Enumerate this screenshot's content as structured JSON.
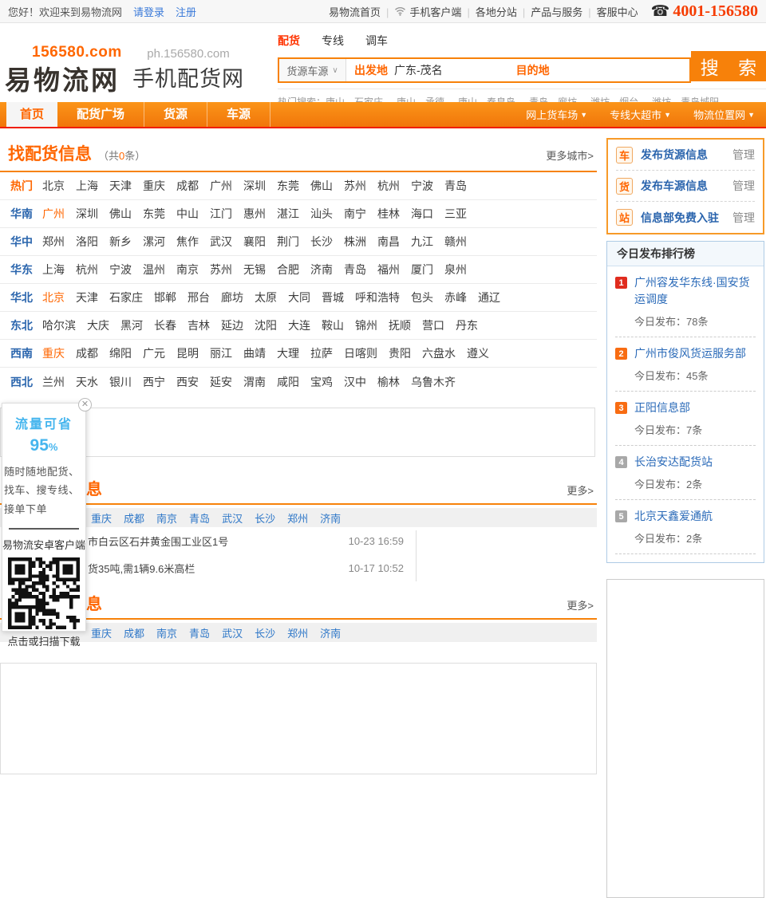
{
  "topbar": {
    "welcome": "您好！欢迎来到易物流网",
    "login": "请登录",
    "register": "注册",
    "home_link": "易物流首页",
    "links": [
      "手机客户端",
      "各地分站",
      "产品与服务",
      "客服中心"
    ],
    "phone": "4001-156580"
  },
  "header": {
    "logo_domain": "156580.com",
    "logo_name": "易物流网",
    "sub_domain": "ph.156580.com",
    "sub_name": "手机配货网",
    "search": {
      "tabs": [
        "配货",
        "专线",
        "调车"
      ],
      "active_tab": 0,
      "category": "货源车源",
      "from_label": "出发地",
      "from_value": "广东-茂名",
      "to_label": "目的地",
      "button": "搜 索",
      "hot_label": "热门搜索：",
      "hot": [
        "唐山→石家庄",
        "唐山→承德",
        "唐山→秦皇岛",
        "青岛→廊坊",
        "潍坊→烟台",
        "潍坊→青岛城阳"
      ]
    }
  },
  "nav": {
    "items": [
      "首页",
      "配货广场",
      "货源",
      "车源"
    ],
    "active_index": 0,
    "right": [
      "网上货车场",
      "专线大超市",
      "物流位置网"
    ]
  },
  "find": {
    "title": "找配货信息",
    "count_prefix": "（共",
    "count": "0",
    "count_suffix": "条）",
    "more": "更多城市>",
    "rows": [
      {
        "label": "热门",
        "label_style": "hot",
        "highlight": [],
        "cities": [
          "北京",
          "上海",
          "天津",
          "重庆",
          "成都",
          "广州",
          "深圳",
          "东莞",
          "佛山",
          "苏州",
          "杭州",
          "宁波",
          "青岛"
        ]
      },
      {
        "label": "华南",
        "label_style": "region",
        "highlight": [
          0
        ],
        "cities": [
          "广州",
          "深圳",
          "佛山",
          "东莞",
          "中山",
          "江门",
          "惠州",
          "湛江",
          "汕头",
          "南宁",
          "桂林",
          "海口",
          "三亚"
        ]
      },
      {
        "label": "华中",
        "label_style": "region",
        "highlight": [],
        "cities": [
          "郑州",
          "洛阳",
          "新乡",
          "漯河",
          "焦作",
          "武汉",
          "襄阳",
          "荆门",
          "长沙",
          "株洲",
          "南昌",
          "九江",
          "赣州"
        ]
      },
      {
        "label": "华东",
        "label_style": "region",
        "highlight": [],
        "cities": [
          "上海",
          "杭州",
          "宁波",
          "温州",
          "南京",
          "苏州",
          "无锡",
          "合肥",
          "济南",
          "青岛",
          "福州",
          "厦门",
          "泉州"
        ]
      },
      {
        "label": "华北",
        "label_style": "region",
        "highlight": [
          0
        ],
        "cities": [
          "北京",
          "天津",
          "石家庄",
          "邯郸",
          "邢台",
          "廊坊",
          "太原",
          "大同",
          "晋城",
          "呼和浩特",
          "包头",
          "赤峰",
          "通辽"
        ]
      },
      {
        "label": "东北",
        "label_style": "region",
        "highlight": [],
        "cities": [
          "哈尔滨",
          "大庆",
          "黑河",
          "长春",
          "吉林",
          "延边",
          "沈阳",
          "大连",
          "鞍山",
          "锦州",
          "抚顺",
          "营口",
          "丹东"
        ]
      },
      {
        "label": "西南",
        "label_style": "region",
        "highlight": [
          0
        ],
        "cities": [
          "重庆",
          "成都",
          "绵阳",
          "广元",
          "昆明",
          "丽江",
          "曲靖",
          "大理",
          "拉萨",
          "日喀则",
          "贵阳",
          "六盘水",
          "遵义"
        ]
      },
      {
        "label": "西北",
        "label_style": "region",
        "highlight": [],
        "cities": [
          "兰州",
          "天水",
          "银川",
          "西宁",
          "西安",
          "延安",
          "渭南",
          "咸阳",
          "宝鸡",
          "汉中",
          "榆林",
          "乌鲁木齐"
        ]
      }
    ]
  },
  "sections": [
    {
      "title": "最新货源信息",
      "more": "更多>",
      "cities": [
        "重庆",
        "成都",
        "南京",
        "青岛",
        "武汉",
        "长沙",
        "郑州",
        "济南"
      ],
      "items": [
        {
          "text": "市白云区石井黄金围工业区1号",
          "time": "10-23 16:59"
        },
        {
          "text": "货35吨,需1辆9.6米高栏",
          "time": "10-17 10:52"
        }
      ]
    },
    {
      "title": "最新车源信息",
      "more": "更多>",
      "cities": [
        "重庆",
        "成都",
        "南京",
        "青岛",
        "武汉",
        "长沙",
        "郑州",
        "济南"
      ],
      "items": []
    }
  ],
  "sidebar": {
    "publish": [
      {
        "icon": "车",
        "label": "发布货源信息",
        "manage": "管理"
      },
      {
        "icon": "货",
        "label": "发布车源信息",
        "manage": "管理"
      },
      {
        "icon": "站",
        "label": "信息部免费入驻",
        "manage": "管理"
      }
    ],
    "ranking": {
      "title": "今日发布排行榜",
      "items": [
        {
          "rank": "1",
          "badge": "red",
          "name": "广州容发华东线·国安货运调度",
          "count": "今日发布：78条"
        },
        {
          "rank": "2",
          "badge": "orange",
          "name": "广州市俊风货运服务部",
          "count": "今日发布：45条"
        },
        {
          "rank": "3",
          "badge": "orange",
          "name": "正阳信息部",
          "count": "今日发布：7条"
        },
        {
          "rank": "4",
          "badge": "gray",
          "name": "长治安达配货站",
          "count": "今日发布：2条"
        },
        {
          "rank": "5",
          "badge": "gray",
          "name": "北京天鑫爱通航",
          "count": "今日发布：2条"
        }
      ]
    }
  },
  "promo": {
    "line1": "流量可省",
    "percent": "95",
    "percent_unit": "%",
    "desc": "随时随地配货、找车、搜专线、接单下单",
    "client": "易物流安卓客户端",
    "download": "点击或扫描下载",
    "close": "✕"
  }
}
